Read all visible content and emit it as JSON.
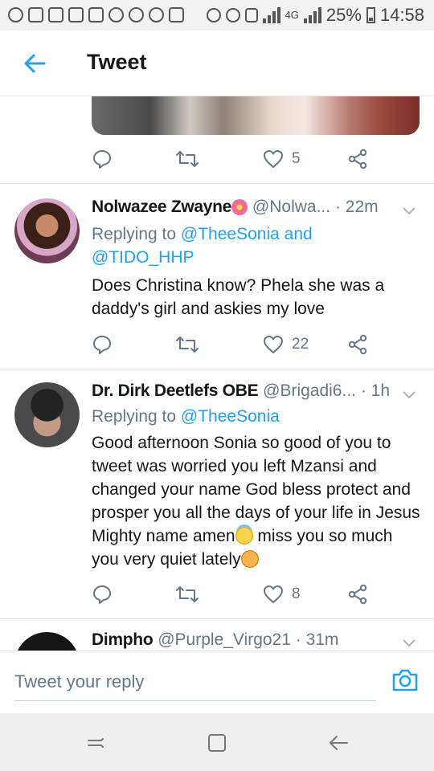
{
  "status_bar": {
    "battery": "25%",
    "time": "14:58",
    "network": "4G"
  },
  "app_bar": {
    "title": "Tweet",
    "back_icon": "arrow-left-icon"
  },
  "colors": {
    "accent": "#1da1f2",
    "secondary_text": "#657786",
    "divider": "#e1e8ed"
  },
  "first_tweet_actions": {
    "reply_count": "",
    "retweet_count": "",
    "like_count": "5"
  },
  "replies": [
    {
      "name": "Nolwazee Zwayne",
      "handle": "@Nolwa...",
      "time": "· 22m",
      "replying_prefix": "Replying to ",
      "replying_to": "@TheeSonia and @TIDO_HHP",
      "body": "Does Christina know? Phela she was a daddy's girl and askies my love",
      "like_count": "22"
    },
    {
      "name": "Dr. Dirk Deetlefs OBE",
      "handle": "@Brigadi6...",
      "time": "· 1h",
      "replying_prefix": "Replying to ",
      "replying_to": "@TheeSonia",
      "body_part1": "Good afternoon Sonia so good of you to tweet was worried you left Mzansi and changed your name God bless protect and prosper you all the days of your life in Jesus Mighty name amen",
      "body_part2": " miss you so much you very quiet lately",
      "like_count": "8"
    },
    {
      "name": "Dimpho",
      "handle": "@Purple_Virgo21",
      "time": "· 31m"
    }
  ],
  "reply_bar": {
    "placeholder": "Tweet your reply"
  }
}
